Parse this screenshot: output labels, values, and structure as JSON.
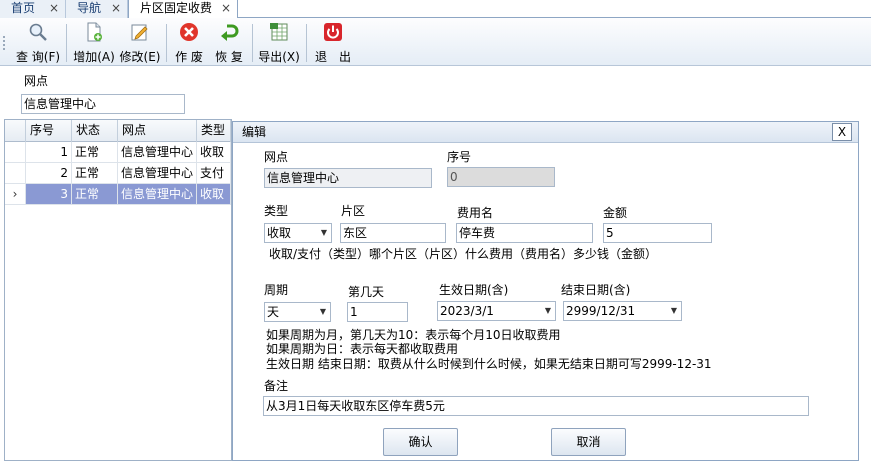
{
  "tabs": [
    {
      "label": "首页"
    },
    {
      "label": "导航"
    },
    {
      "label": "片区固定收费"
    }
  ],
  "tab_close_glyph": "×",
  "toolbar": {
    "query": "查 询(F)",
    "add": "增加(A)",
    "edit": "修改(E)",
    "void": "作 废",
    "restore": "恢 复",
    "export": "导出(X)",
    "exit": "退　出"
  },
  "filter": {
    "outlet_label": "网点",
    "outlet_value": "信息管理中心"
  },
  "grid": {
    "headers": [
      "序号",
      "状态",
      "网点",
      "类型"
    ],
    "rows": [
      {
        "no": "1",
        "status": "正常",
        "outlet": "信息管理中心",
        "type": "收取"
      },
      {
        "no": "2",
        "status": "正常",
        "outlet": "信息管理中心",
        "type": "支付"
      },
      {
        "no": "3",
        "status": "正常",
        "outlet": "信息管理中心",
        "type": "收取"
      }
    ],
    "row_indicator": "›"
  },
  "dialog": {
    "title": "编辑",
    "close": "X",
    "outlet_label": "网点",
    "outlet_value": "信息管理中心",
    "seq_label": "序号",
    "seq_value": "0",
    "type_label": "类型",
    "type_value": "收取",
    "area_label": "片区",
    "area_value": "东区",
    "fee_label": "费用名",
    "fee_value": "停车费",
    "amount_label": "金额",
    "amount_value": "5",
    "hint1": "收取/支付（类型）哪个片区（片区）什么费用（费用名）多少钱（金额）",
    "period_label": "周期",
    "period_value": "天",
    "day_label": "第几天",
    "day_value": "1",
    "start_label": "生效日期(含)",
    "start_value": "2023/3/1",
    "end_label": "结束日期(含)",
    "end_value": "2999/12/31",
    "hint2": "如果周期为月，第几天为10：表示每个月10日收取费用",
    "hint3": "如果周期为日：表示每天都收取费用",
    "hint4": "生效日期 结束日期：取费从什么时候到什么时候，如果无结束日期可写2999-12-31",
    "remark_label": "备注",
    "remark_value": "从3月1日每天收取东区停车费5元",
    "ok": "确认",
    "cancel": "取消"
  },
  "colors": {
    "selected_row": "#8a99d3",
    "exit_icon": "#d8262c",
    "void_icon": "#e0352b",
    "restore_icon": "#3e9a21"
  }
}
